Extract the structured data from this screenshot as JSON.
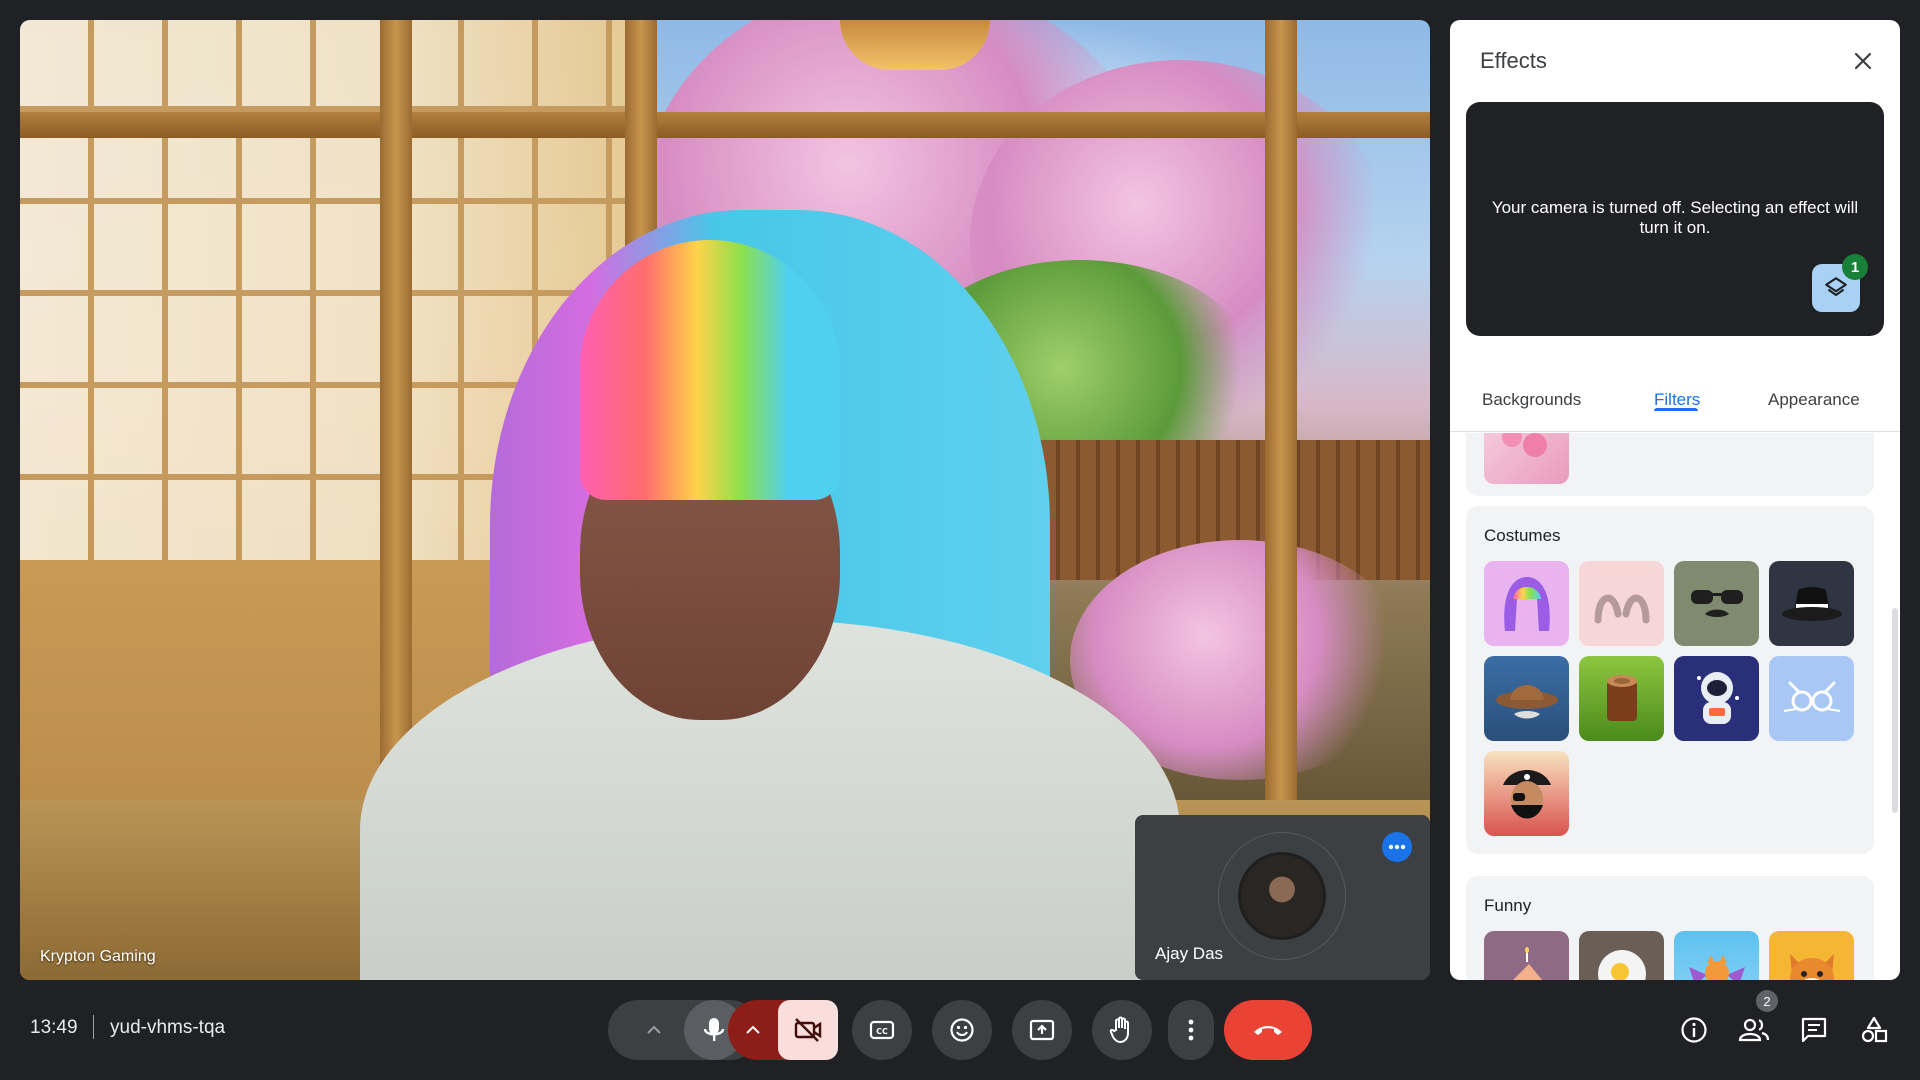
{
  "main_video": {
    "participant_label": "Krypton Gaming"
  },
  "self_view": {
    "name": "Ajay Das",
    "more_icon": "more-horiz-icon"
  },
  "effects_panel": {
    "title": "Effects",
    "close_icon": "close-icon",
    "preview_message": "Your camera is turned off. Selecting an effect will turn it on.",
    "applied_effects_count": "1",
    "tabs": [
      {
        "label": "Backgrounds",
        "active": false
      },
      {
        "label": "Filters",
        "active": true
      },
      {
        "label": "Appearance",
        "active": false
      }
    ],
    "sections": [
      {
        "title": "",
        "items": [
          "cherry-blossom-filter"
        ]
      },
      {
        "title": "Costumes",
        "items": [
          "rainbow-wig",
          "bunny-ears",
          "sunglasses-mustache",
          "black-fedora",
          "cowboy-hat",
          "tree-stump",
          "astronaut",
          "cat-glasses",
          "pirate"
        ]
      },
      {
        "title": "Funny",
        "items": [
          "birthday-cake",
          "fried-egg",
          "flying-cat",
          "cat-face"
        ]
      }
    ]
  },
  "bottom_bar": {
    "time": "13:49",
    "meeting_code": "yud-vhms-tqa",
    "participants_count": "2",
    "controls": [
      "audio-options-chevron",
      "microphone",
      "video-options-chevron",
      "camera-off",
      "captions",
      "reactions",
      "present-screen",
      "raise-hand",
      "more-options",
      "leave-call"
    ],
    "right_controls": [
      "meeting-details",
      "people",
      "chat",
      "activities"
    ]
  },
  "colors": {
    "background": "#202124",
    "control": "#3c4043",
    "camera_off_bg": "#f9dedc",
    "camera_off_chevron_bg": "#8c1d18",
    "leave": "#ea4335",
    "accent": "#1a73e8",
    "badge_green": "#188038"
  }
}
